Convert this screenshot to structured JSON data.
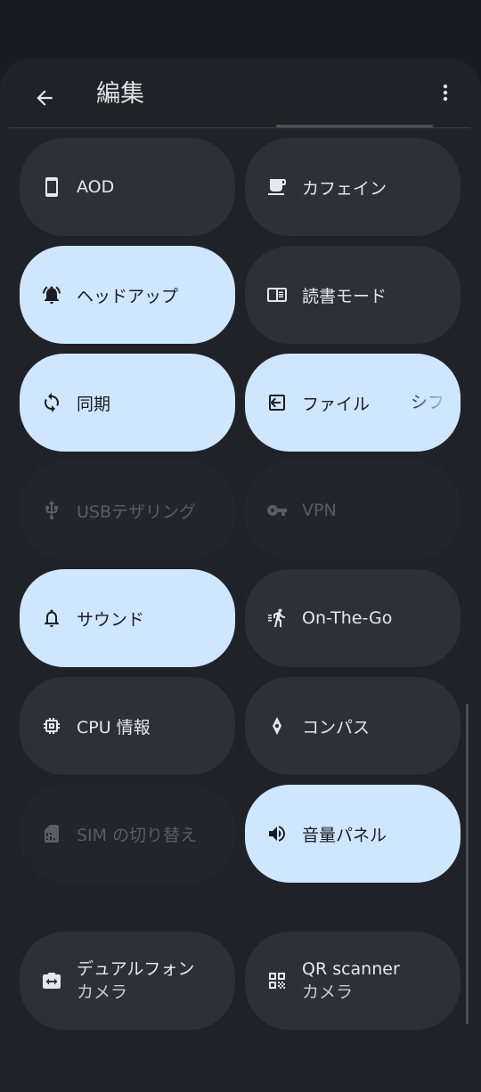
{
  "header": {
    "title": "編集"
  },
  "tiles": [
    {
      "label": "AOD",
      "state": "off",
      "icon": "phone-icon"
    },
    {
      "label": "カフェイン",
      "state": "off",
      "icon": "coffee-icon"
    },
    {
      "label": "ヘッドアップ",
      "state": "on",
      "icon": "bell-alert-icon"
    },
    {
      "label": "読書モード",
      "state": "off",
      "icon": "reading-mode-icon"
    },
    {
      "label": "同期",
      "state": "on",
      "icon": "sync-icon"
    },
    {
      "label": "ファイル",
      "label_tail": "シフ",
      "state": "on",
      "icon": "file-transfer-icon"
    },
    {
      "label": "USBテザリング",
      "state": "disabled",
      "icon": "usb-icon"
    },
    {
      "label": "VPN",
      "state": "disabled",
      "icon": "vpn-key-icon"
    },
    {
      "label": "サウンド",
      "state": "on",
      "icon": "bell-icon"
    },
    {
      "label": "On-The-Go",
      "state": "off",
      "icon": "otg-run-icon"
    },
    {
      "label": "CPU 情報",
      "state": "off",
      "icon": "cpu-icon"
    },
    {
      "label": "コンパス",
      "state": "off",
      "icon": "compass-icon"
    },
    {
      "label": "SIM の切り替え",
      "state": "disabled",
      "icon": "sim-icon"
    },
    {
      "label": "音量パネル",
      "state": "on",
      "icon": "volume-icon"
    },
    {
      "label": "デュアルフォン",
      "sublabel": "カメラ",
      "state": "off",
      "icon": "camera-switch-icon"
    },
    {
      "label": "QR scanner",
      "sublabel": "カメラ",
      "state": "off",
      "icon": "qr-code-icon"
    }
  ],
  "colors": {
    "tile_on": "#cfe6ff",
    "tile_off": "#2d3034",
    "tile_disabled": "#222529",
    "background": "#191c20"
  }
}
